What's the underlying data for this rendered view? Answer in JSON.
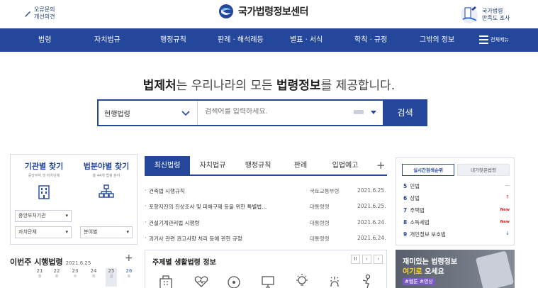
{
  "header": {
    "feedback": [
      "오류문의",
      "개선의견"
    ],
    "logo_text": "국가법령정보센터",
    "survey": [
      "국가법령",
      "만족도 조사"
    ]
  },
  "nav": {
    "items": [
      "법령",
      "자치법규",
      "행정규칙",
      "판례 · 해석례등",
      "별표 · 서식",
      "학칙 · 규정",
      "그밖의 정보"
    ],
    "all_menu": "전체메뉴"
  },
  "hero": {
    "pre": "법제처",
    "mid": "는 우리나라의 모든 ",
    "bold": "법령정보",
    "post": "를 제공합니다."
  },
  "search": {
    "scope": "현행법령",
    "placeholder": "검색어를 입력하세요.",
    "button": "검색"
  },
  "left_panel": {
    "org_title": "기관별 찾기",
    "org_sub": "중앙부처 및 자치단체",
    "field_title": "법분야별 찾기",
    "field_sub": "총 44개 법령 분야",
    "select_central": "중앙부처기관",
    "select_local": "자치단체",
    "select_field": "분야별"
  },
  "weekly": {
    "title": "이번주 시행법령",
    "date": "2021.6.25",
    "plus": "+",
    "days": [
      {
        "n": "21",
        "w": "월"
      },
      {
        "n": "22",
        "w": "화"
      },
      {
        "n": "23",
        "w": "수"
      },
      {
        "n": "24",
        "w": "목"
      },
      {
        "n": "25",
        "w": "금"
      },
      {
        "n": "26",
        "w": "토"
      }
    ]
  },
  "news": {
    "tabs": [
      "최신법령",
      "자치법규",
      "행정규칙",
      "판례",
      "입법예고"
    ],
    "plus": "+",
    "rows": [
      {
        "title": "건축법 시행규칙",
        "org": "국토교통부령",
        "date": "2021.6.25."
      },
      {
        "title": "포항지진의 진상조사 및 피해구제 등을 위한 특별법...",
        "org": "대통령령",
        "date": "2021.6.25."
      },
      {
        "title": "건설기계관리법 시행령",
        "org": "대통령령",
        "date": "2021.6.24."
      },
      {
        "title": "과거사 관련 권고사항 처리 등에 관한 규정",
        "org": "대통령령",
        "date": "2021.6.24."
      }
    ]
  },
  "theme": {
    "title": "주제별 생활법령 정보",
    "ctrl": [
      "II",
      "‹",
      "›"
    ],
    "icons": [
      "building-icon",
      "heart-icon",
      "shield-icon",
      "monitor-icon",
      "bulb-icon",
      "sparkle-icon",
      "person-icon"
    ]
  },
  "rank": {
    "tab_active": "실시간검색순위",
    "tab_other": "내가찾은법령",
    "items": [
      {
        "n": "5",
        "name": "민법",
        "change": "—",
        "kind": "same"
      },
      {
        "n": "6",
        "name": "상법",
        "change": "↑",
        "kind": "up"
      },
      {
        "n": "7",
        "name": "주택법",
        "change": "New",
        "kind": "new"
      },
      {
        "n": "8",
        "name": "소득세법",
        "change": "New",
        "kind": "new"
      },
      {
        "n": "9",
        "name": "개인정보 보호법",
        "change": "↓",
        "kind": "down"
      }
    ]
  },
  "banner": {
    "line1": "재미있는 법령정보",
    "line2_hl": "여기로",
    "line2_rest": " 오세요",
    "tag": "#웹툰 #영상"
  },
  "colors": {
    "primary": "#24479b",
    "up": "#e02020",
    "down": "#2f5fc4"
  }
}
